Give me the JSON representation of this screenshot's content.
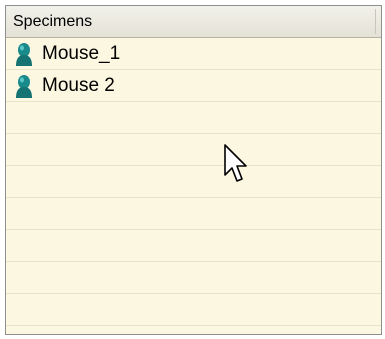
{
  "panel": {
    "header": "Specimens",
    "items": [
      {
        "label": "Mouse_1",
        "icon": "person-icon"
      },
      {
        "label": "Mouse 2",
        "icon": "person-icon"
      }
    ]
  },
  "colors": {
    "list_background": "#fcf7e0",
    "row_line": "#eae4c6",
    "icon_teal": "#1a8a8a"
  }
}
